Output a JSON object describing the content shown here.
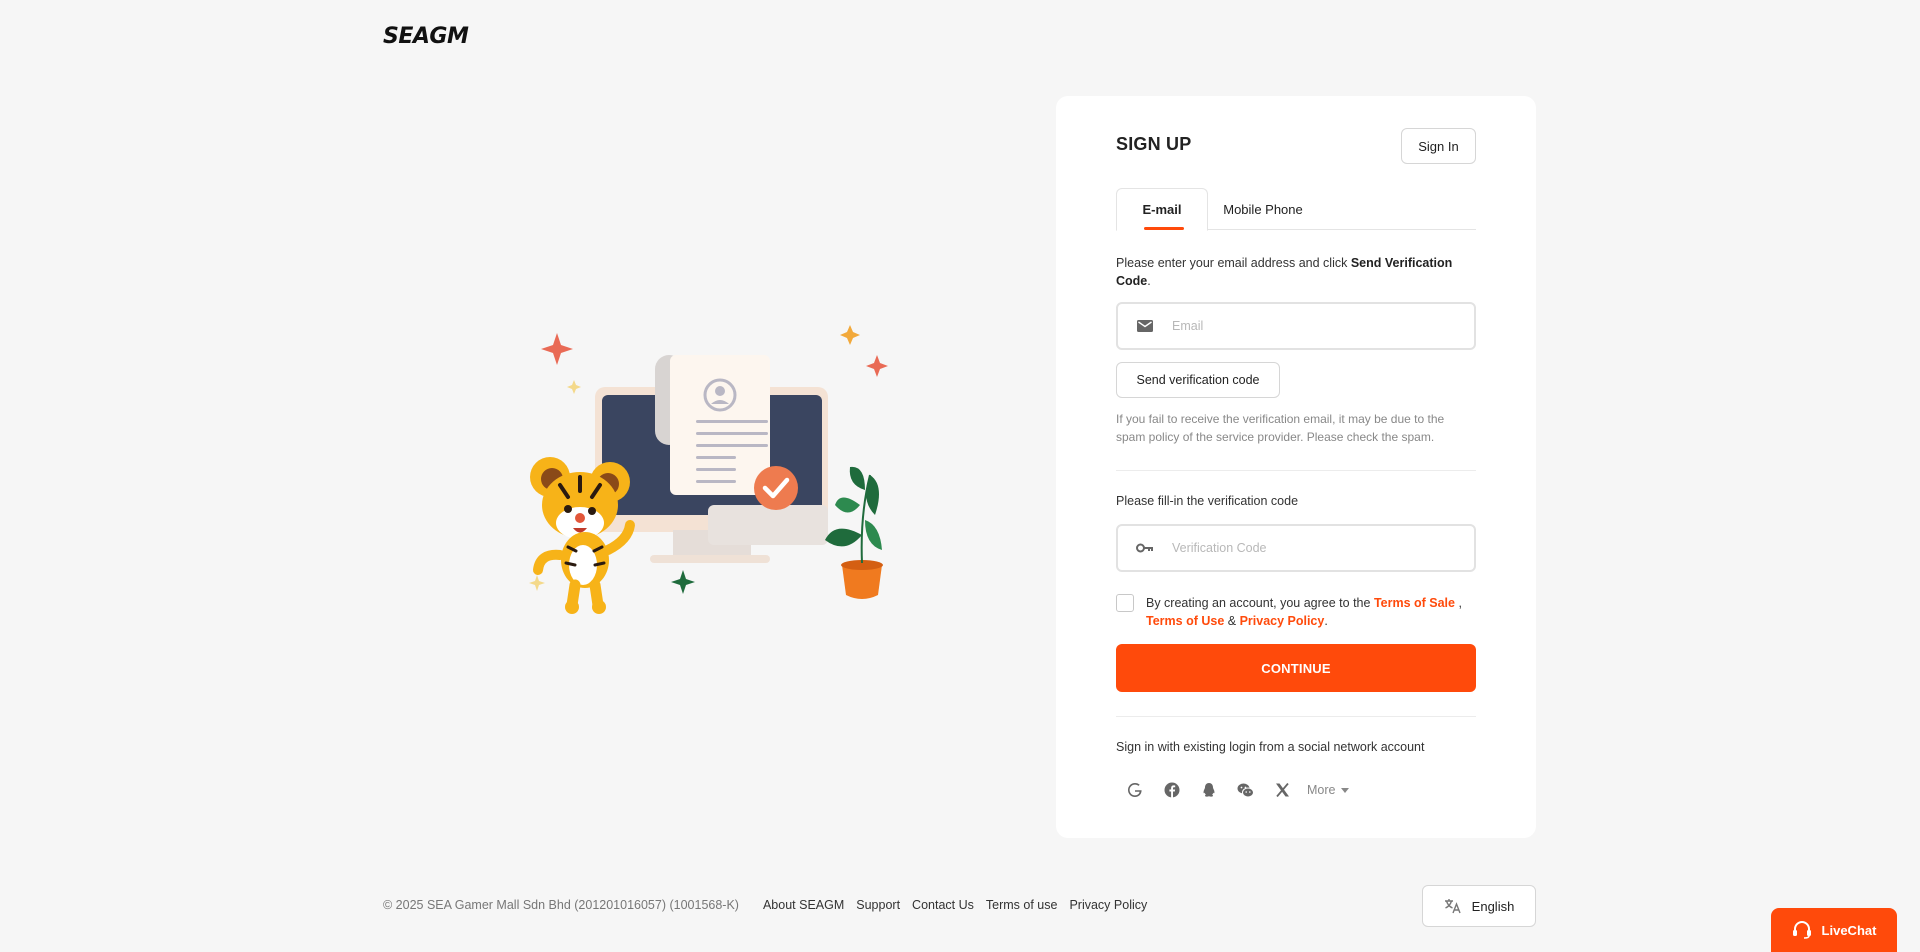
{
  "brand": {
    "logo": "SEAGM"
  },
  "signup": {
    "title": "SIGN UP",
    "signin_label": "Sign In",
    "tabs": [
      {
        "label": "E-mail",
        "active": true
      },
      {
        "label": "Mobile Phone",
        "active": false
      }
    ],
    "instruction_prefix": "Please enter your email address and click ",
    "instruction_bold": "Send Verification Code",
    "instruction_suffix": ".",
    "email_placeholder": "Email",
    "send_code_label": "Send verification code",
    "hint": "If you fail to receive the verification email, it may be due to the spam policy of the service provider. Please check the spam.",
    "code_label": "Please fill-in the verification code",
    "code_placeholder": "Verification Code",
    "agree_prefix": "By creating an account, you agree to the ",
    "terms_of_sale": "Terms of Sale",
    "agree_comma": " ,",
    "terms_of_use": "Terms of Use",
    "agree_amp": " & ",
    "privacy_policy": "Privacy Policy",
    "agree_end": ".",
    "continue_label": "CONTINUE",
    "social_label": "Sign in with existing login from a social network account",
    "social_icons": [
      "google-icon",
      "facebook-icon",
      "qq-icon",
      "wechat-icon",
      "x-icon"
    ],
    "more_label": "More"
  },
  "footer": {
    "copyright": "© 2025 SEA Gamer Mall Sdn Bhd (201201016057) (1001568-K)",
    "links": [
      "About SEAGM",
      "Support",
      "Contact Us",
      "Terms of use",
      "Privacy Policy"
    ],
    "language": "English"
  },
  "livechat": {
    "label": "LiveChat"
  },
  "colors": {
    "accent": "#ff4a0b",
    "background": "#f6f6f6",
    "card": "#ffffff"
  }
}
